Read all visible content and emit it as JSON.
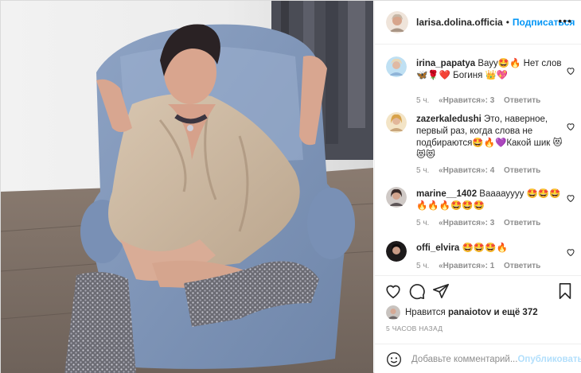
{
  "post": {
    "username": "larisa.dolina.officia",
    "dot": "•",
    "follow_label": "Подписаться",
    "more_label": "•••"
  },
  "comments": [
    {
      "user": "irina_papatya",
      "text": "Вауу🤩🔥 Нет слов 🦋🌹❤️ Богиня 👑💖",
      "time": "5 ч.",
      "likes": "«Нравится»: 3",
      "reply": "Ответить"
    },
    {
      "user": "zazerkaledushi",
      "text": "Это, наверное, первый раз, когда слова не подбираются🤩🔥💜Какой шик 😻😻😻",
      "time": "5 ч.",
      "likes": "«Нравится»: 4",
      "reply": "Ответить"
    },
    {
      "user": "marine__1402",
      "text": "Ваааауууу 🤩🤩🤩🔥🔥🔥🤩🤩🤩",
      "time": "5 ч.",
      "likes": "«Нравится»: 3",
      "reply": "Ответить"
    },
    {
      "user": "offi_elvira",
      "text": "🤩🤩🤩🔥",
      "time": "5 ч.",
      "likes": "«Нравится»: 1",
      "reply": "Ответить"
    }
  ],
  "likes": {
    "prefix": "Нравится",
    "user": "panaiotov",
    "suffix": "и ещё 372"
  },
  "time_ago": "5 ЧАСОВ НАЗАД",
  "add_comment": {
    "placeholder": "Добавьте комментарий...",
    "post_label": "Опубликовать"
  },
  "colors": {
    "link": "#0095f6",
    "post_disabled": "#b2dffc",
    "muted": "#8e8e8e",
    "text": "#262626"
  },
  "icons": [
    "heart-icon",
    "comment-icon",
    "share-icon",
    "bookmark-icon",
    "emoji-icon"
  ]
}
